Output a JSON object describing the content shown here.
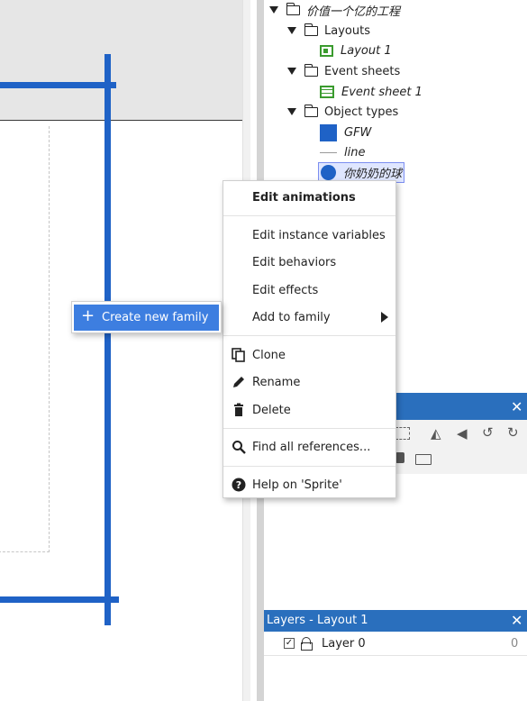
{
  "project": {
    "root": "价值一个亿的工程",
    "layouts_folder": "Layouts",
    "layout_item": "Layout 1",
    "event_folder": "Event sheets",
    "event_item": "Event sheet 1",
    "objects_folder": "Object types",
    "objects": [
      "GFW",
      "line",
      "你奶奶的球"
    ]
  },
  "context_menu": {
    "edit_animations": "Edit animations",
    "edit_instance_variables": "Edit instance variables",
    "edit_behaviors": "Edit behaviors",
    "edit_effects": "Edit effects",
    "add_to_family": "Add to family",
    "clone": "Clone",
    "rename": "Rename",
    "delete": "Delete",
    "find_all_references": "Find all references...",
    "help": "Help on 'Sprite'"
  },
  "submenu": {
    "create_new_family": "Create new family"
  },
  "panels": {
    "close_glyph": "✕"
  },
  "layers": {
    "title": "Layers - Layout 1",
    "layer_name": "Layer 0",
    "layer_index": "0"
  },
  "colors": {
    "accent": "#2a6fbd",
    "canvas_line": "#1f62c6",
    "selection": "#3d7ee0",
    "green_icon": "#3a9b2e"
  }
}
